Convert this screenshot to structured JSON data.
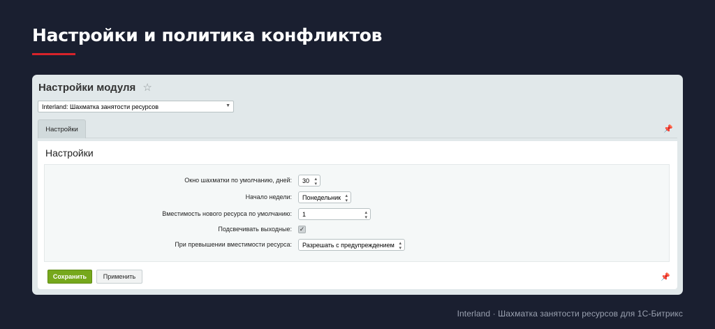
{
  "slide": {
    "title": "Настройки и политика конфликтов",
    "footer": "Interland · Шахматка занятости ресурсов для 1С-Битрикс"
  },
  "window": {
    "title": "Настройки модуля",
    "module_select": "Interland: Шахматка занятости ресурсов",
    "tab": "Настройки",
    "section_title": "Настройки"
  },
  "fields": [
    {
      "label": "Окно шахматки по умолчанию, дней:",
      "value": "30"
    },
    {
      "label": "Начало недели:",
      "value": "Понедельник"
    },
    {
      "label": "Вместимость нового ресурса по умолчанию:",
      "value": "1"
    },
    {
      "label": "Подсвечивать выходные:",
      "checked": true
    },
    {
      "label": "При превышении вместимости ресурса:",
      "value": "Разрешать с предупреждением"
    }
  ],
  "buttons": {
    "save": "Сохранить",
    "apply": "Применить"
  },
  "icons": {
    "star": "star-icon",
    "pin": "pin-icon",
    "select_arrow": "chevron-down-icon",
    "spinner": "spinner-icon",
    "checkbox": "checkmark-icon"
  },
  "colors": {
    "background": "#1a1f30",
    "accent_underline": "#d8232a",
    "save_button": "#76a81c",
    "window_bg": "#e1e8ea"
  }
}
